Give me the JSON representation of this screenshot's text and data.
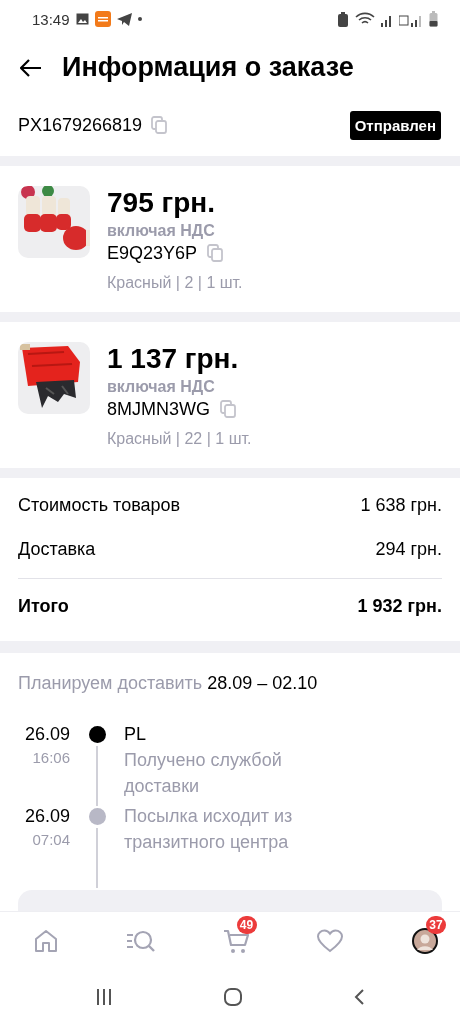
{
  "status_bar": {
    "time": "13:49"
  },
  "header": {
    "title": "Информация о заказе"
  },
  "order": {
    "number": "PX1679266819",
    "status": "Отправлен"
  },
  "items": [
    {
      "price": "795 грн.",
      "vat_note": "включая НДС",
      "sku": "E9Q23Y6P",
      "details": "Красный | 2 | 1 шт."
    },
    {
      "price": "1 137 грн.",
      "vat_note": "включая НДС",
      "sku": "8MJMN3WG",
      "details": "Красный | 22 | 1 шт."
    }
  ],
  "summary": [
    {
      "kind": "line",
      "label": "Стоимость товаров",
      "value": "1 638 грн."
    },
    {
      "kind": "line",
      "label": "Доставка",
      "value": "294 грн."
    },
    {
      "kind": "total",
      "label": "Итого",
      "value": "1 932 грн."
    }
  ],
  "delivery": {
    "label": "Планируем доставить",
    "dates": "28.09 – 02.10",
    "events": [
      {
        "date": "26.09",
        "time": "16:06",
        "place": "PL",
        "description": "Получено службой доставки",
        "current": true
      },
      {
        "date": "26.09",
        "time": "07:04",
        "description": "Посылка исходит из транзитного центра",
        "current": false
      }
    ]
  },
  "bottom_nav": [
    {
      "kind": "home"
    },
    {
      "kind": "catalog"
    },
    {
      "kind": "cart",
      "badge": "49"
    },
    {
      "kind": "favorites"
    },
    {
      "kind": "profile",
      "badge": "37"
    }
  ]
}
